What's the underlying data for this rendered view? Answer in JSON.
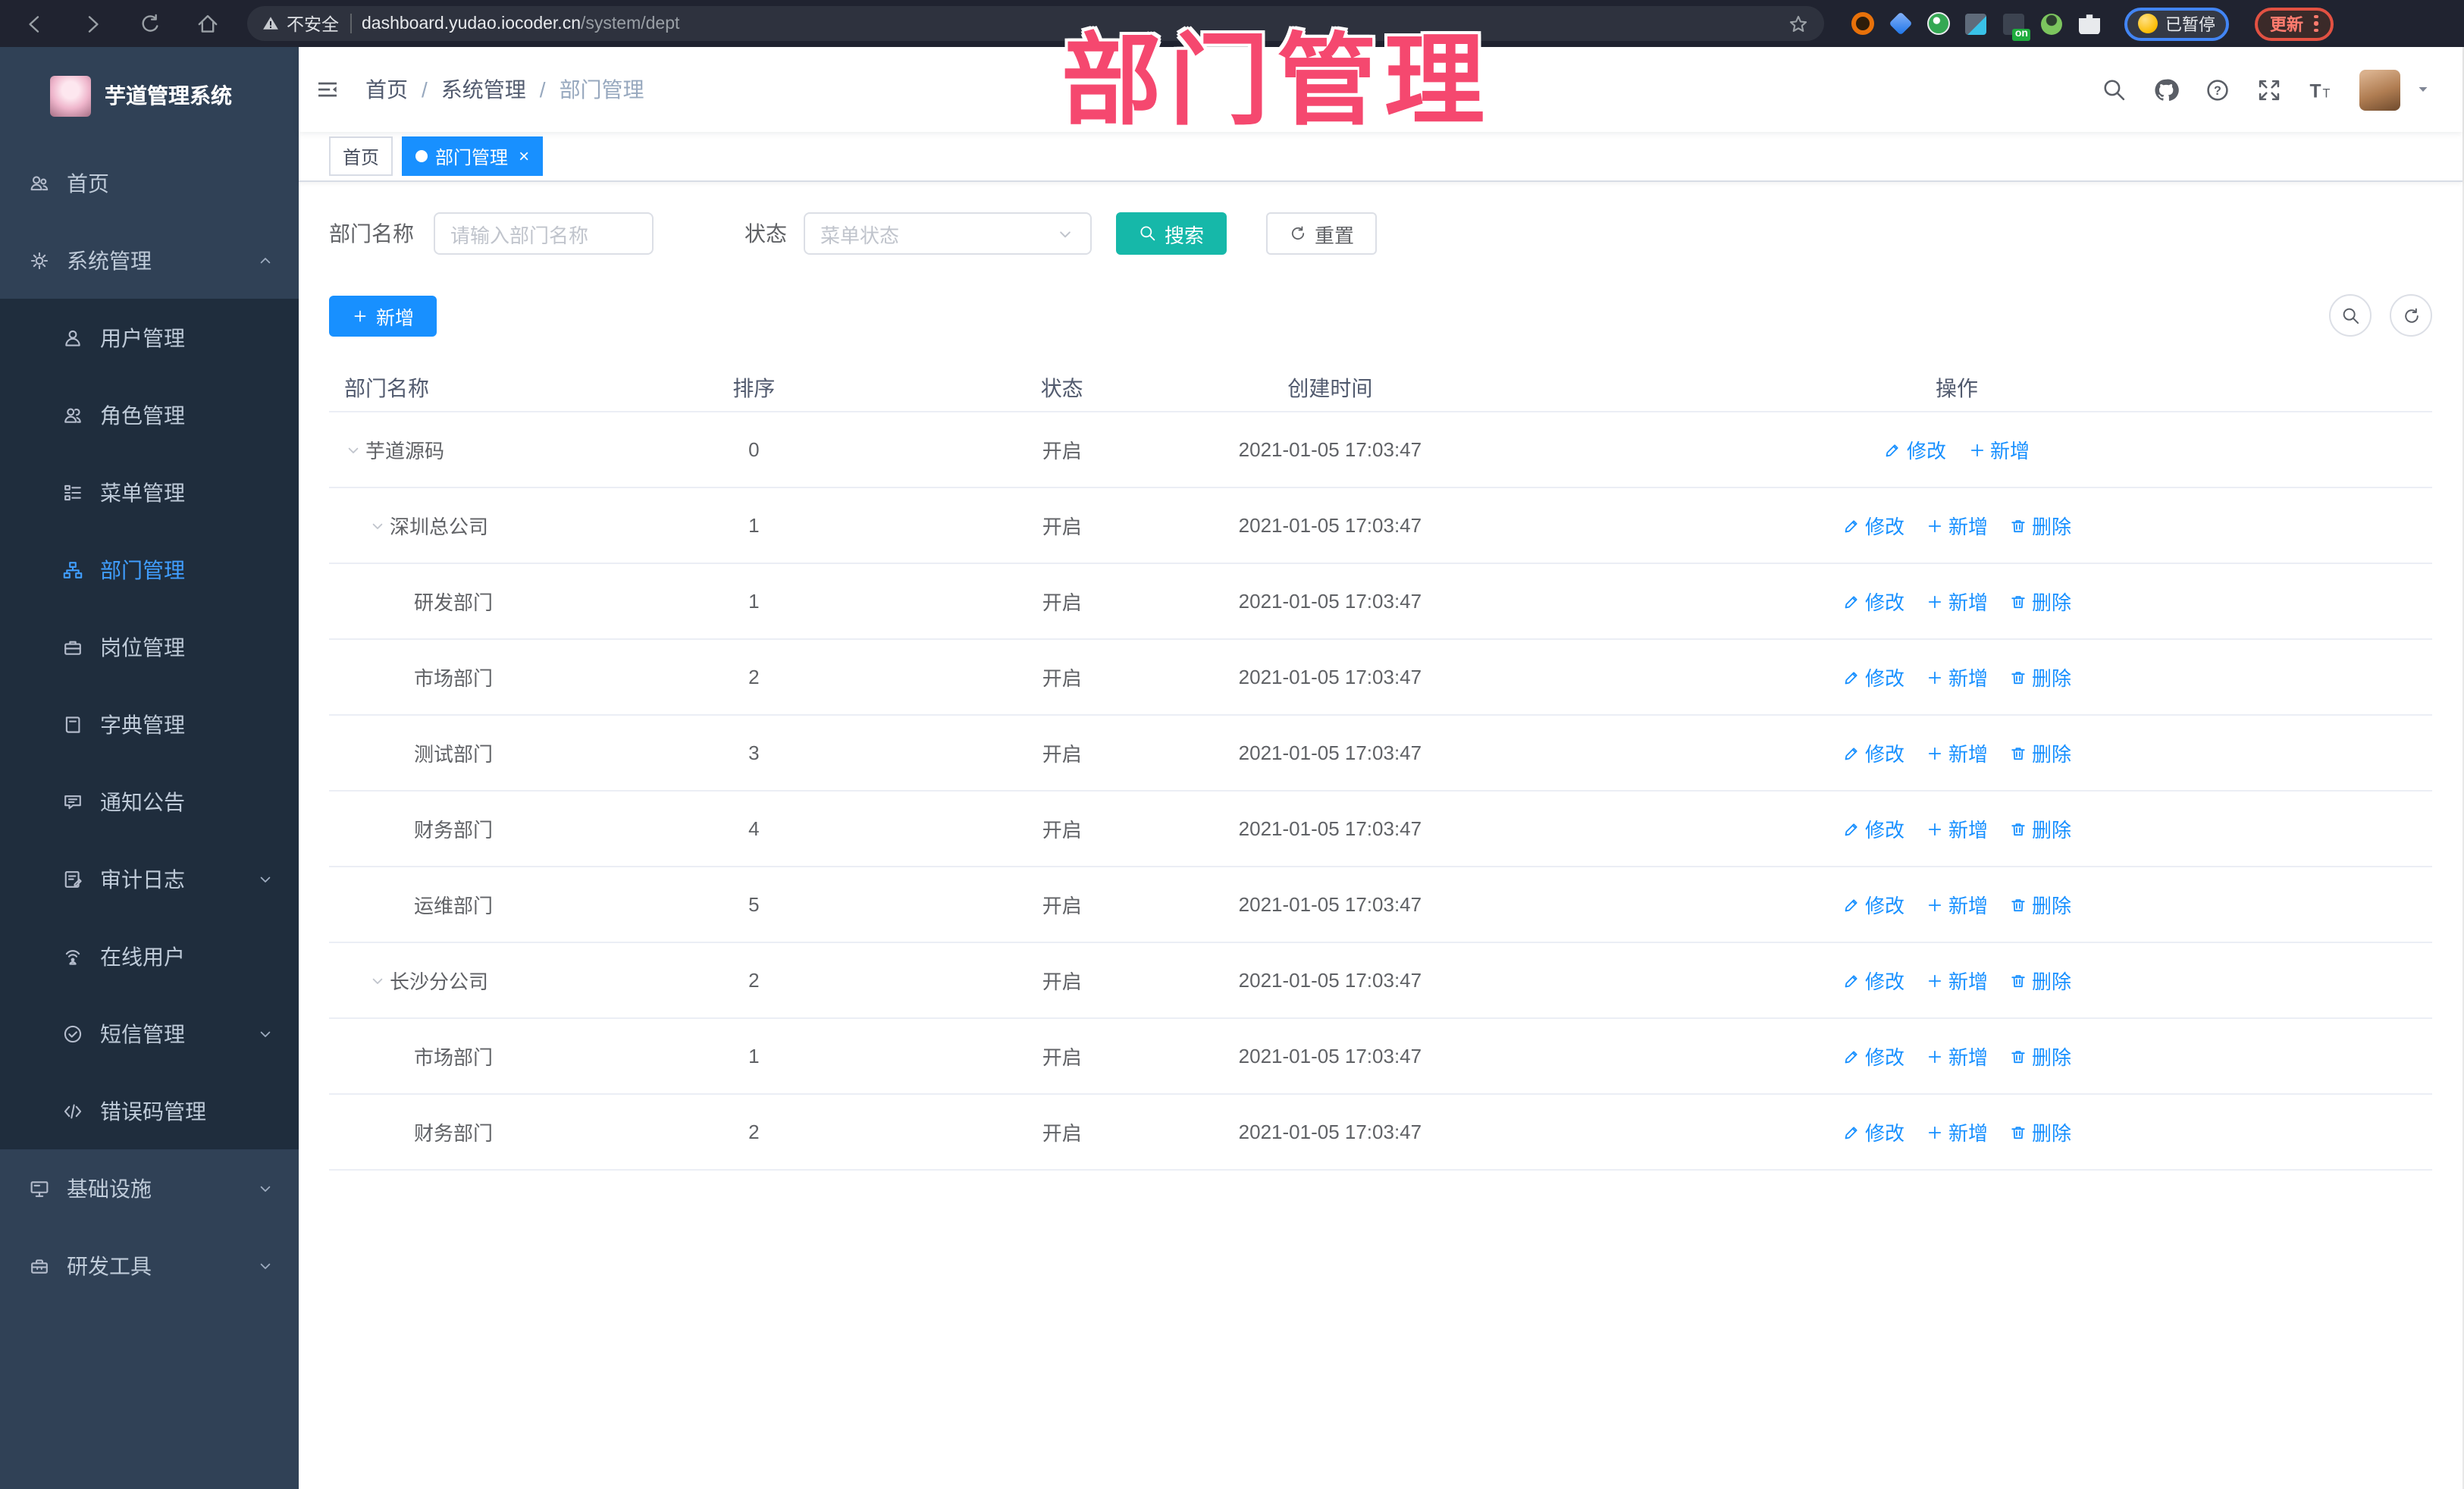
{
  "watermark_text": "部门管理",
  "colors": {
    "primary": "#1890ff",
    "menu_active": "#409eff",
    "search_teal": "#16b8a9",
    "watermark_pink": "#f5486f",
    "sidebar_bg": "#304156",
    "submenu_bg": "#1f2d3d",
    "browser_bar_bg": "#202330"
  },
  "browser": {
    "nav_icons": [
      "back-icon",
      "forward-icon",
      "reload-icon",
      "home-icon"
    ],
    "address": {
      "warning_label": "不安全",
      "host": "dashboard.yudao.iocoder.cn",
      "path": "/system/dept"
    },
    "extension_icons": [
      "orange-ring-extension-icon",
      "blue-gem-extension-icon",
      "green-circle-extension-icon",
      "tiles-extension-icon",
      "proxy-on-extension-icon",
      "green-person-extension-icon",
      "puzzle-extension-icon"
    ],
    "proxy_on_badge": "on",
    "paused_label": "已暂停",
    "update_label": "更新"
  },
  "app": {
    "title": "芋道管理系统"
  },
  "sidebar": {
    "items": [
      {
        "label": "首页",
        "icon": "peoples-icon",
        "level": 0
      },
      {
        "label": "系统管理",
        "icon": "gear-icon",
        "level": 0,
        "chevron": "up"
      },
      {
        "label": "用户管理",
        "icon": "user-icon",
        "level": 1
      },
      {
        "label": "角色管理",
        "icon": "roles-icon",
        "level": 1
      },
      {
        "label": "菜单管理",
        "icon": "menu-tree-icon",
        "level": 1
      },
      {
        "label": "部门管理",
        "icon": "org-tree-icon",
        "level": 1,
        "active": true
      },
      {
        "label": "岗位管理",
        "icon": "briefcase-icon",
        "level": 1
      },
      {
        "label": "字典管理",
        "icon": "dictionary-icon",
        "level": 1
      },
      {
        "label": "通知公告",
        "icon": "announcement-icon",
        "level": 1
      },
      {
        "label": "审计日志",
        "icon": "audit-log-icon",
        "level": 1,
        "chevron": "down"
      },
      {
        "label": "在线用户",
        "icon": "online-users-icon",
        "level": 1
      },
      {
        "label": "短信管理",
        "icon": "sms-icon",
        "level": 1,
        "chevron": "down"
      },
      {
        "label": "错误码管理",
        "icon": "error-code-icon",
        "level": 1
      },
      {
        "label": "基础设施",
        "icon": "infrastructure-icon",
        "level": 0,
        "chevron": "down"
      },
      {
        "label": "研发工具",
        "icon": "devtools-icon",
        "level": 0,
        "chevron": "down"
      }
    ]
  },
  "header": {
    "breadcrumb": [
      "首页",
      "系统管理",
      "部门管理"
    ],
    "icon_names": [
      "search-icon",
      "github-icon",
      "help-icon",
      "fullscreen-icon",
      "font-size-icon"
    ]
  },
  "tabs": [
    {
      "label": "首页",
      "active": false,
      "closable": false
    },
    {
      "label": "部门管理",
      "active": true,
      "closable": true
    }
  ],
  "filter": {
    "name_label": "部门名称",
    "name_placeholder": "请输入部门名称",
    "status_label": "状态",
    "status_placeholder": "菜单状态",
    "search_label": "搜索",
    "reset_label": "重置"
  },
  "toolbar": {
    "add_label": "新增"
  },
  "table": {
    "columns": [
      "部门名称",
      "排序",
      "状态",
      "创建时间",
      "操作"
    ],
    "rows": [
      {
        "name": "芋道源码",
        "level": 0,
        "expandable": true,
        "sort": "0",
        "status": "开启",
        "created": "2021-01-05 17:03:47",
        "actions": [
          {
            "label": "修改",
            "icon": "edit-icon"
          },
          {
            "label": "新增",
            "icon": "plus-icon"
          }
        ]
      },
      {
        "name": "深圳总公司",
        "level": 1,
        "expandable": true,
        "sort": "1",
        "status": "开启",
        "created": "2021-01-05 17:03:47",
        "actions": [
          {
            "label": "修改",
            "icon": "edit-icon"
          },
          {
            "label": "新增",
            "icon": "plus-icon"
          },
          {
            "label": "删除",
            "icon": "trash-icon"
          }
        ]
      },
      {
        "name": "研发部门",
        "level": 2,
        "expandable": false,
        "sort": "1",
        "status": "开启",
        "created": "2021-01-05 17:03:47",
        "actions": [
          {
            "label": "修改",
            "icon": "edit-icon"
          },
          {
            "label": "新增",
            "icon": "plus-icon"
          },
          {
            "label": "删除",
            "icon": "trash-icon"
          }
        ]
      },
      {
        "name": "市场部门",
        "level": 2,
        "expandable": false,
        "sort": "2",
        "status": "开启",
        "created": "2021-01-05 17:03:47",
        "actions": [
          {
            "label": "修改",
            "icon": "edit-icon"
          },
          {
            "label": "新增",
            "icon": "plus-icon"
          },
          {
            "label": "删除",
            "icon": "trash-icon"
          }
        ]
      },
      {
        "name": "测试部门",
        "level": 2,
        "expandable": false,
        "sort": "3",
        "status": "开启",
        "created": "2021-01-05 17:03:47",
        "actions": [
          {
            "label": "修改",
            "icon": "edit-icon"
          },
          {
            "label": "新增",
            "icon": "plus-icon"
          },
          {
            "label": "删除",
            "icon": "trash-icon"
          }
        ]
      },
      {
        "name": "财务部门",
        "level": 2,
        "expandable": false,
        "sort": "4",
        "status": "开启",
        "created": "2021-01-05 17:03:47",
        "actions": [
          {
            "label": "修改",
            "icon": "edit-icon"
          },
          {
            "label": "新增",
            "icon": "plus-icon"
          },
          {
            "label": "删除",
            "icon": "trash-icon"
          }
        ]
      },
      {
        "name": "运维部门",
        "level": 2,
        "expandable": false,
        "sort": "5",
        "status": "开启",
        "created": "2021-01-05 17:03:47",
        "actions": [
          {
            "label": "修改",
            "icon": "edit-icon"
          },
          {
            "label": "新增",
            "icon": "plus-icon"
          },
          {
            "label": "删除",
            "icon": "trash-icon"
          }
        ]
      },
      {
        "name": "长沙分公司",
        "level": 1,
        "expandable": true,
        "sort": "2",
        "status": "开启",
        "created": "2021-01-05 17:03:47",
        "actions": [
          {
            "label": "修改",
            "icon": "edit-icon"
          },
          {
            "label": "新增",
            "icon": "plus-icon"
          },
          {
            "label": "删除",
            "icon": "trash-icon"
          }
        ]
      },
      {
        "name": "市场部门",
        "level": 2,
        "expandable": false,
        "sort": "1",
        "status": "开启",
        "created": "2021-01-05 17:03:47",
        "actions": [
          {
            "label": "修改",
            "icon": "edit-icon"
          },
          {
            "label": "新增",
            "icon": "plus-icon"
          },
          {
            "label": "删除",
            "icon": "trash-icon"
          }
        ]
      },
      {
        "name": "财务部门",
        "level": 2,
        "expandable": false,
        "sort": "2",
        "status": "开启",
        "created": "2021-01-05 17:03:47",
        "actions": [
          {
            "label": "修改",
            "icon": "edit-icon"
          },
          {
            "label": "新增",
            "icon": "plus-icon"
          },
          {
            "label": "删除",
            "icon": "trash-icon"
          }
        ]
      }
    ]
  }
}
